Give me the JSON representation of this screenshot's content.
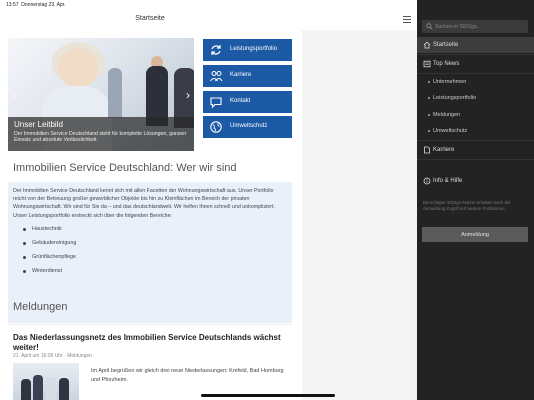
{
  "status": {
    "time": "13:57",
    "date": "Donnerstag 23. Apr."
  },
  "header": {
    "title": "Startseite",
    "menu_icon": "hamburger-icon"
  },
  "hero": {
    "heading": "Unser Leitbild",
    "text": "Der Immobilien Service Deutschland steht für komplette Lösungen, ganzen Einsatz und absolute Verlässlichkeit."
  },
  "tiles": [
    {
      "label": "Leistungsportfolio",
      "icon": "refresh-icon"
    },
    {
      "label": "Karriere",
      "icon": "people-icon"
    },
    {
      "label": "Kontakt",
      "icon": "speech-bubble-icon"
    },
    {
      "label": "Umweltschutz",
      "icon": "globe-icon"
    }
  ],
  "about": {
    "title": "Immobilien Service Deutschland: Wer wir sind",
    "text": "Der Immobilien Service Deutschland kennt sich mit allen Facetten der Wohnungswirtschaft aus. Unser Portfolio reicht von der Betreuung großer gewerblicher Objekte bis hin zu Kleinflächen im Bereich der privaten Wohnungswirtschaft. Wir sind für Sie da – und das deutschlandweit. Wir helfen Ihnen schnell und unkompliziert. Unser Leistungsportfolio erstreckt sich über die folgenden Bereiche:",
    "services": [
      "Haustechnik",
      "Gebäudereinigung",
      "Grünflächenpflege",
      "Winterdienst"
    ]
  },
  "news": {
    "section_title": "Meldungen",
    "items": [
      {
        "title": "Das Niederlassungsnetz des Immobilien Service Deutschlands wächst weiter!",
        "date": "21. April um 16:09 Uhr · Meldungen",
        "text": "Im April begrüßen wir gleich drei neue Niederlassungen: Krefeld, Bad Homburg und Pforzheim."
      }
    ]
  },
  "drawer": {
    "search_placeholder": "Suchen in ISD2go...",
    "items": [
      {
        "label": "Startseite",
        "icon": "home-icon"
      },
      {
        "label": "Top News",
        "icon": "news-icon"
      }
    ],
    "subitems": [
      "Unternehmen",
      "Leistungsportfolio",
      "Meldungen",
      "Umweltschutz"
    ],
    "item_karriere": {
      "label": "Karriere",
      "icon": "document-icon"
    },
    "item_info": {
      "label": "Info & Hilfe",
      "icon": "info-icon"
    },
    "login_text": "Berechtigte ISD2go-Nutzer erhalten nach der Anmeldung Zugriff auf weitere Funktionen.",
    "login_button": "Anmeldung"
  }
}
